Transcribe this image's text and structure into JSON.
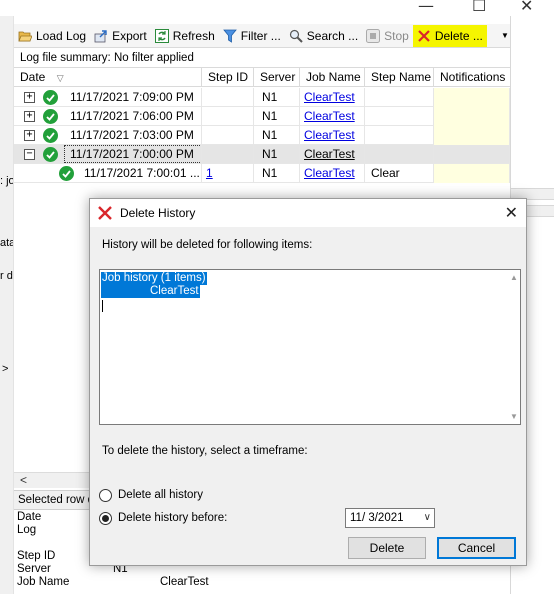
{
  "toolbar": {
    "load_log": "Load Log",
    "export": "Export",
    "refresh": "Refresh",
    "filter": "Filter ...",
    "search": "Search ...",
    "stop": "Stop",
    "delete": "Delete ..."
  },
  "summary": "Log file summary: No filter applied",
  "columns": [
    "Date",
    "Step ID",
    "Server",
    "Job Name",
    "Step Name",
    "Notifications"
  ],
  "rows": [
    {
      "expander": "+",
      "date": "11/17/2021 7:09:00 PM",
      "step_id": "",
      "server": "N1",
      "job": "ClearTest",
      "step_name": ""
    },
    {
      "expander": "+",
      "date": "11/17/2021 7:06:00 PM",
      "step_id": "",
      "server": "N1",
      "job": "ClearTest",
      "step_name": ""
    },
    {
      "expander": "+",
      "date": "11/17/2021 7:03:00 PM",
      "step_id": "",
      "server": "N1",
      "job": "ClearTest",
      "step_name": ""
    },
    {
      "expander": "−",
      "date": "11/17/2021 7:00:00 PM",
      "step_id": "",
      "server": "N1",
      "job": "ClearTest",
      "step_name": ""
    },
    {
      "expander": "",
      "date": "11/17/2021 7:00:01 ...",
      "step_id": "1",
      "server": "N1",
      "job": "ClearTest",
      "step_name": "Clear"
    }
  ],
  "left_fragments": [
    ": jo",
    "ata",
    "r d",
    ">"
  ],
  "lower": {
    "selected_row": "Selected row d",
    "details": {
      "date_label": "Date",
      "log_label": "Log",
      "step_id_label": "Step ID",
      "server_label": "Server",
      "server_value": "N1",
      "job_name_label": "Job Name",
      "job_name_value": "ClearTest"
    }
  },
  "dialog": {
    "title": "Delete History",
    "intro": "History will be deleted for following items:",
    "items": [
      "Job history (1 items)",
      "ClearTest"
    ],
    "timeframe_prompt": "To delete the history, select a timeframe:",
    "option_all": "Delete all history",
    "option_before": "Delete history before:",
    "selected_option": "before",
    "date_value": "11/  3/2021",
    "delete_button": "Delete",
    "cancel_button": "Cancel"
  },
  "colors": {
    "accent": "#0078d7",
    "highlight": "#f5f500",
    "success": "#22a03a",
    "link": "#0000e0",
    "danger": "#d9262b"
  }
}
